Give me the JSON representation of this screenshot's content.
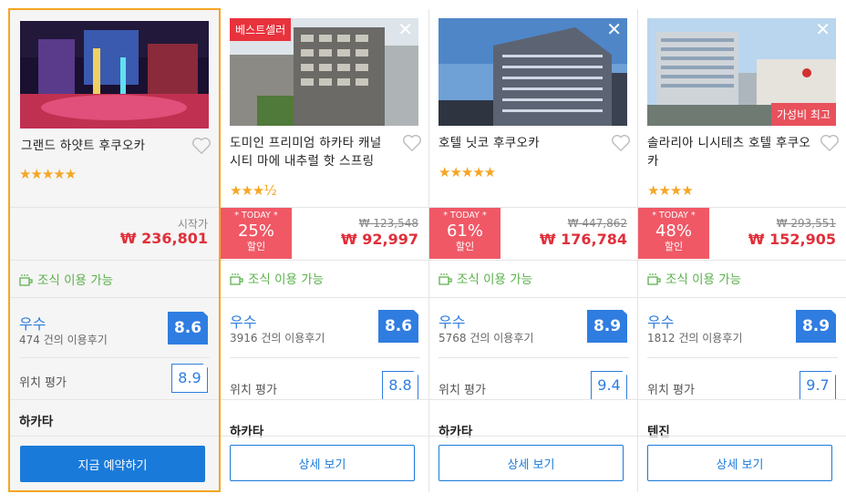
{
  "colors": {
    "accent_blue": "#2f7de1",
    "price_red": "#e02f3a",
    "today_red": "#f05866",
    "star": "#f5a623",
    "breakfast_green": "#5ab04a",
    "selected_border": "#f5a623"
  },
  "hotels": [
    {
      "name": "그랜드 하얏트 후쿠오카",
      "stars": "★★★★★",
      "badge": "",
      "corner_badge": "",
      "close": "",
      "start_label": "시작가",
      "old_price": "",
      "price": "₩ 236,801",
      "today": null,
      "breakfast": "조식 이용 가능",
      "rating_word": "우수",
      "reviews": "474 건의 이용후기",
      "score": "8.6",
      "location_label": "위치 평가",
      "location_score": "8.9",
      "area": "하카타",
      "button": "지금 예약하기"
    },
    {
      "name": "도미인 프리미엄 하카타 캐널 시티 마에 내추럴 핫 스프링",
      "stars": "★★★½",
      "badge": "베스트셀러",
      "corner_badge": "",
      "close": "✕",
      "start_label": "",
      "old_price": "₩ 123,548",
      "price": "₩ 92,997",
      "today": {
        "label": "* TODAY *",
        "pct": "25%",
        "sub": "할인"
      },
      "breakfast": "조식 이용 가능",
      "rating_word": "우수",
      "reviews": "3916 건의 이용후기",
      "score": "8.6",
      "location_label": "위치 평가",
      "location_score": "8.8",
      "area": "하카타",
      "button": "상세 보기"
    },
    {
      "name": "호텔 닛코 후쿠오카",
      "stars": "★★★★★",
      "badge": "",
      "corner_badge": "",
      "close": "✕",
      "start_label": "",
      "old_price": "₩ 447,862",
      "price": "₩ 176,784",
      "today": {
        "label": "* TODAY *",
        "pct": "61%",
        "sub": "할인"
      },
      "breakfast": "조식 이용 가능",
      "rating_word": "우수",
      "reviews": "5768 건의 이용후기",
      "score": "8.9",
      "location_label": "위치 평가",
      "location_score": "9.4",
      "area": "하카타",
      "button": "상세 보기"
    },
    {
      "name": "솔라리아 니시테츠 호텔 후쿠오카",
      "stars": "★★★★",
      "badge": "",
      "corner_badge": "가성비 최고",
      "close": "✕",
      "start_label": "",
      "old_price": "₩ 293,551",
      "price": "₩ 152,905",
      "today": {
        "label": "* TODAY *",
        "pct": "48%",
        "sub": "할인"
      },
      "breakfast": "조식 이용 가능",
      "rating_word": "우수",
      "reviews": "1812 건의 이용후기",
      "score": "8.9",
      "location_label": "위치 평가",
      "location_score": "9.7",
      "area": "텐진",
      "button": "상세 보기"
    }
  ]
}
